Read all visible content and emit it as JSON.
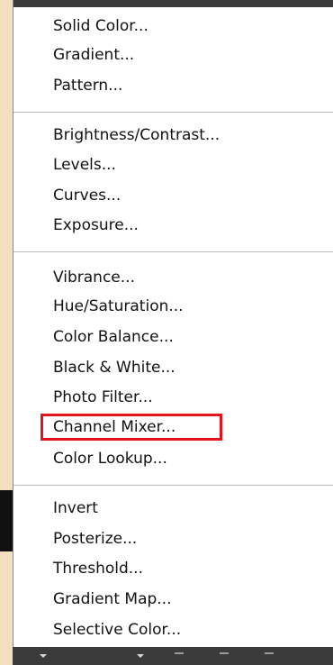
{
  "menu": {
    "groups": [
      {
        "items": [
          "Solid Color...",
          "Gradient...",
          "Pattern..."
        ]
      },
      {
        "items": [
          "Brightness/Contrast...",
          "Levels...",
          "Curves...",
          "Exposure..."
        ]
      },
      {
        "items": [
          "Vibrance...",
          "Hue/Saturation...",
          "Color Balance...",
          "Black & White...",
          "Photo Filter...",
          "Channel Mixer...",
          "Color Lookup..."
        ]
      },
      {
        "items": [
          "Invert",
          "Posterize...",
          "Threshold...",
          "Gradient Map...",
          "Selective Color..."
        ]
      }
    ],
    "highlighted_item": "Channel Mixer..."
  },
  "colors": {
    "highlight_border": "#e5141b",
    "menu_background": "#ffffff",
    "page_background": "#f3dfc0"
  }
}
